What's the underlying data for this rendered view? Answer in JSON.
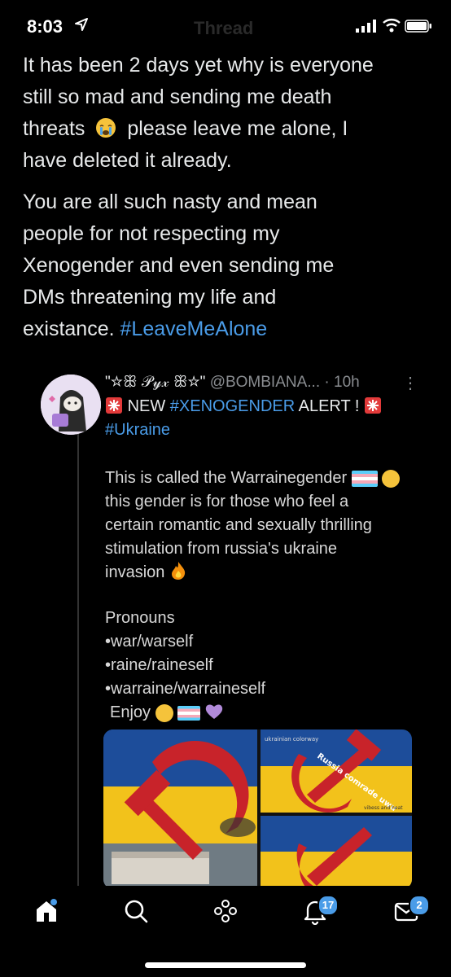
{
  "status_bar": {
    "time": "8:03",
    "ghost_title": "Thread"
  },
  "post": {
    "paragraph1_lines": [
      "It has been 2 days yet why is everyone",
      "still so mad and sending me death",
      "threats",
      "please leave me alone, I",
      "have deleted it already."
    ],
    "paragraph2_lines": [
      "You are all such nasty and mean",
      "people for not respecting my",
      "Xenogender and even sending me",
      "DMs threatening my life and",
      "existance."
    ],
    "hashtag": "#LeaveMeAlone"
  },
  "quoted": {
    "display_name": "\"☆ꕥ 𝒫𝓎𝓍 ꕥ☆\"",
    "handle": "@BOMBIANA...",
    "time": "· 10h",
    "line1_new": "NEW",
    "line1_tag": "#XENOGENDER",
    "line1_alert": "ALERT !",
    "line2_tag": "#Ukraine",
    "body_lines": [
      "This is called the Warrainegender",
      "this gender is for those who feel a",
      "certain romantic and sexually thrilling",
      "stimulation from russia's ukraine",
      "invasion"
    ],
    "pronouns_title": "Pronouns",
    "pronouns": [
      "•war/warself",
      "•raine/raineself",
      "•warraine/warraineself"
    ],
    "enjoy": "Enjoy",
    "image_texts": {
      "top_small": "ukrainian colorway",
      "banner": "Russia comrade uwu",
      "bottom_small": "vibess and heat"
    }
  },
  "tabbar": {
    "notifications_badge": "17",
    "messages_badge": "2"
  },
  "colors": {
    "background": "#000000",
    "link": "#4a9ce8",
    "alert_red": "#e23a3a"
  }
}
